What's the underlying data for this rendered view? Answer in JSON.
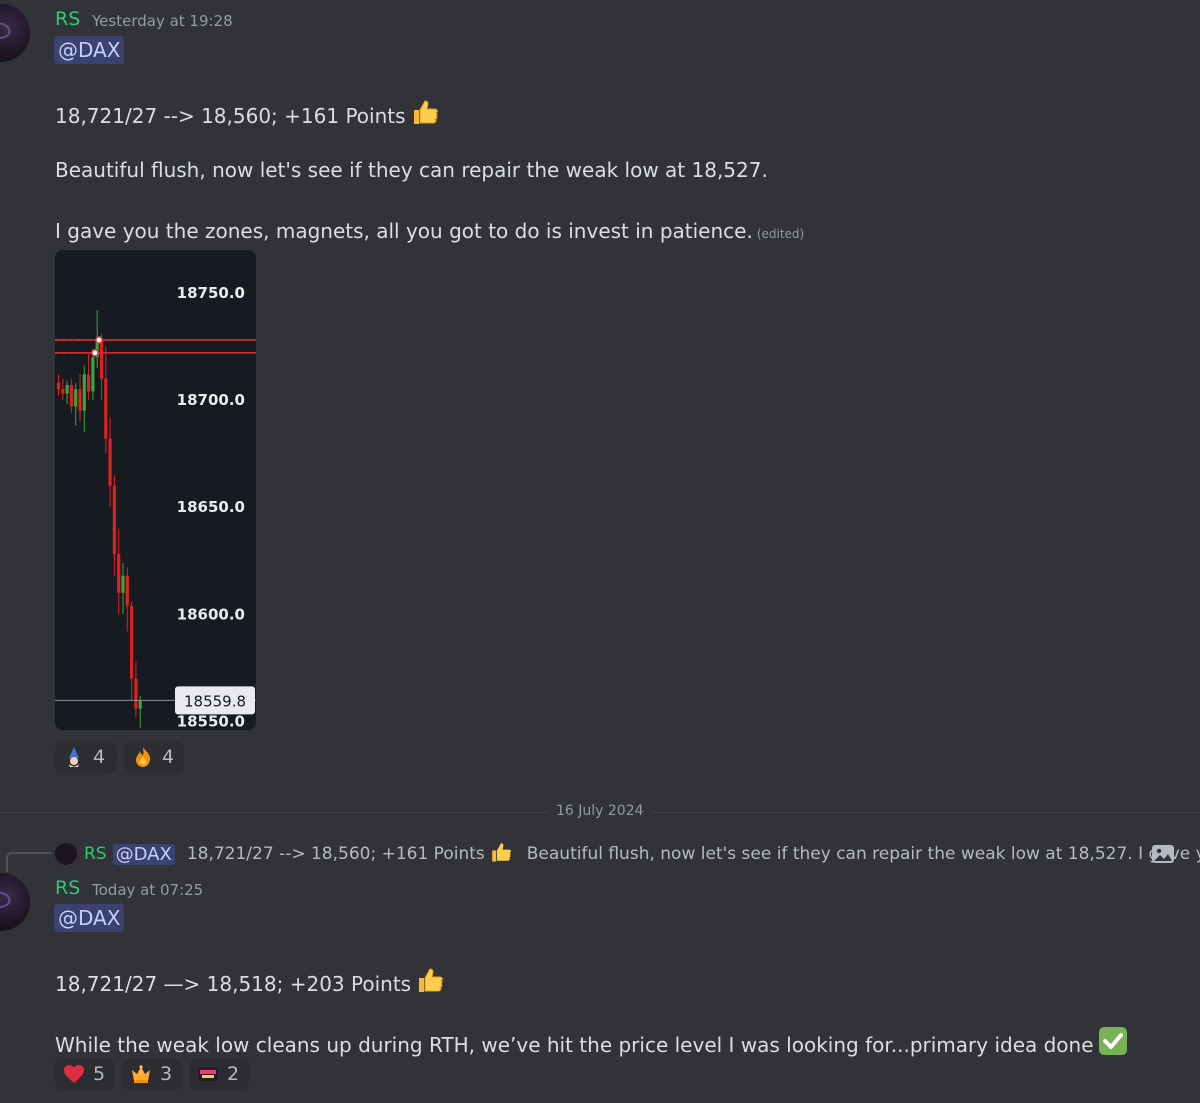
{
  "messages": [
    {
      "author": "RS",
      "timestamp": "Yesterday at 19:28",
      "mention": "@DAX",
      "lines": [
        "18,721/27 --> 18,560; +161 Points",
        "Beautiful flush, now let's see if they can repair the weak low at 18,527.",
        "I gave you the zones, magnets, all you got to do is invest in patience."
      ],
      "edited": "(edited)",
      "reactions": [
        {
          "emoji": "wizard",
          "count": "4"
        },
        {
          "emoji": "fire",
          "count": "4"
        }
      ]
    },
    {
      "author": "RS",
      "timestamp": "Today at 07:25",
      "mention": "@DAX",
      "lines": [
        "18,721/27 —> 18,518; +203 Points",
        "While the weak low cleans up during RTH, we’ve hit the price level I was looking for...primary idea done"
      ],
      "reactions": [
        {
          "emoji": "heart",
          "count": "5"
        },
        {
          "emoji": "crown",
          "count": "3"
        },
        {
          "emoji": "daddy-sticker",
          "count": "2"
        }
      ]
    }
  ],
  "date_divider": "16 July 2024",
  "reply_preview": {
    "author": "RS",
    "mention": "@DAX",
    "text_part1": "18,721/27 --> 18,560; +161 Points",
    "text_part2": "Beautiful flush, now let's see if they can repair the weak low at 18,527.   I gave yo..."
  },
  "chart_data": {
    "type": "candlestick",
    "y_ticks": [
      "18750.0",
      "18700.0",
      "18650.0",
      "18600.0",
      "18550.0"
    ],
    "ylim": [
      18546,
      18770
    ],
    "last_price_label": "18559.8",
    "last_price": 18559.8,
    "horizontal_levels": [
      18728,
      18722
    ],
    "colors": {
      "up": "#3aa53a",
      "down": "#e02020",
      "level": "#e0302e",
      "background": "#161b21"
    }
  }
}
